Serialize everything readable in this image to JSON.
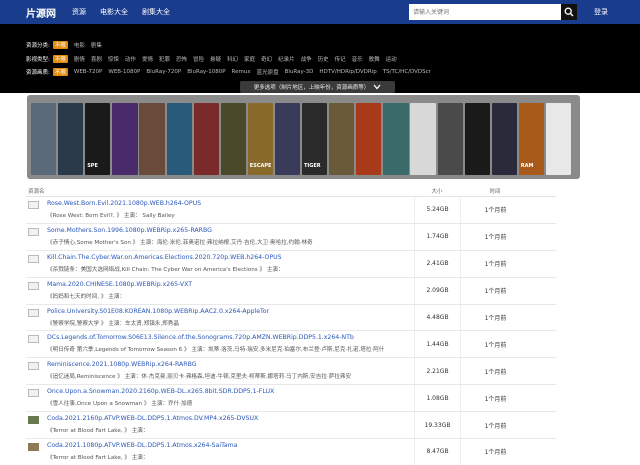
{
  "nav": {
    "logo": "片源网",
    "links": [
      "资源",
      "电影大全",
      "剧集大全"
    ],
    "search_placeholder": "请输入关键词",
    "login": "登录"
  },
  "filters": {
    "rows": [
      {
        "label": "资源分类:",
        "chips": [
          "不限",
          "电影",
          "剧集"
        ]
      },
      {
        "label": "影视类型:",
        "chips": [
          "不限",
          "剧情",
          "喜剧",
          "惊悚",
          "动作",
          "爱情",
          "犯罪",
          "恐怖",
          "冒险",
          "悬疑",
          "科幻",
          "家庭",
          "奇幻",
          "纪录片",
          "战争",
          "历史",
          "传记",
          "音乐",
          "歌舞",
          "运动"
        ]
      },
      {
        "label": "资源画质:",
        "chips": [
          "不限",
          "WEB-720P",
          "WEB-1080P",
          "BluRay-720P",
          "BluRay-1080P",
          "Remux",
          "蓝光原盘",
          "BluRay-3D",
          "HDTV/HDRip/DVDRip",
          "TS/TC/HC/DVDScr"
        ]
      }
    ],
    "more_options": "更多选项（制片地区，上映年份，资源画质等）"
  },
  "posters": [
    {
      "color": "#5a6a7a",
      "label": ""
    },
    {
      "color": "#2a3a4a",
      "label": ""
    },
    {
      "color": "#1a1a1a",
      "label": "SPE"
    },
    {
      "color": "#4a2a6a",
      "label": ""
    },
    {
      "color": "#6a4a3a",
      "label": ""
    },
    {
      "color": "#2a5a7a",
      "label": ""
    },
    {
      "color": "#7a2a2a",
      "label": ""
    },
    {
      "color": "#4a4a2a",
      "label": ""
    },
    {
      "color": "#8a6a2a",
      "label": "ESCAPE"
    },
    {
      "color": "#3a3a5a",
      "label": ""
    },
    {
      "color": "#2a2a2a",
      "label": "TIGER"
    },
    {
      "color": "#6a5a3a",
      "label": ""
    },
    {
      "color": "#a83a1a",
      "label": ""
    },
    {
      "color": "#3a6a6a",
      "label": ""
    },
    {
      "color": "#d8d8d8",
      "label": ""
    },
    {
      "color": "#4a4a4a",
      "label": ""
    },
    {
      "color": "#1a1a1a",
      "label": ""
    },
    {
      "color": "#2a2a3a",
      "label": ""
    },
    {
      "color": "#a85a1a",
      "label": "RAM"
    },
    {
      "color": "#e8e8e8",
      "label": ""
    }
  ],
  "table": {
    "headers": {
      "name": "资源名",
      "size": "大小",
      "time": "时间"
    },
    "rows": [
      {
        "title": "Rose.West.Born.Evil.2021.1080p.WEB.h264-OPUS",
        "sub": "《Rose West: Born Evil?, 》 主演： Sally Bailey",
        "size": "5.24GB",
        "time": "1个月前",
        "thumb": ""
      },
      {
        "title": "Some.Mothers.Son.1996.1080p.WEBRip.x265-RARBG",
        "sub": "《赤子情心,Some Mother's Son 》 主演：海伦·米伦,菲奥诺拉·弗拉纳根,艾丹·吉伦,大卫·奥哈拉,约翰·林奇",
        "size": "1.74GB",
        "time": "1个月前",
        "thumb": ""
      },
      {
        "title": "Kill.Chain.The.Cyber.War.on.Americas.Elections.2020.720p.WEB.h264-OPUS",
        "sub": "《杀戮链条：美国大选网络战,Kill Chain: The Cyber War on America's Elections 》 主演：",
        "size": "2.41GB",
        "time": "1个月前",
        "thumb": ""
      },
      {
        "title": "Mama.2020.CHINESE.1080p.WEBRip.x265-VXT",
        "sub": "《妈妈和七天的时间, 》 主演：",
        "size": "2.09GB",
        "time": "1个月前",
        "thumb": ""
      },
      {
        "title": "Police.University.S01E08.KOREAN.1080p.WEBRip.AAC2.0.x264-AppleTor",
        "sub": "《警察学院,警察大学 》 主演：车太贤,郑镇永,郑秀晶",
        "size": "4.48GB",
        "time": "1个月前",
        "thumb": ""
      },
      {
        "title": "DCs.Legends.of.Tomorrow.S06E13.Silence.of.the.Sonograms.720p.AMZN.WEBRip.DDP5.1.x264-NTb",
        "sub": "《明日传奇 第六季,Legends of Tomorrow Season 6 》 主演：凯蒂·洛茨,马特·瑞安,多米尼克·珀塞尔,布兰登·卢斯,尼克·扎诺,塔拉·阿什",
        "size": "1.44GB",
        "time": "1个月前",
        "thumb": ""
      },
      {
        "title": "Reminiscence.2021.1080p.WEBRip.x264-RARBG",
        "sub": "《追忆迷局,Reminiscence 》 主演：休·杰克曼,丽贝卡·弗格森,坦迪·牛顿,克里夫·柯蒂斯,娜塔莉·马丁内斯,安吉拉·萨拉弗安",
        "size": "2.21GB",
        "time": "1个月前",
        "thumb": ""
      },
      {
        "title": "Once.Upon.a.Snowman.2020.2160p.WEB-DL.x265.8bit.SDR.DDP5.1-FLUX",
        "sub": "《雪人往事,Once Upon a Snowman 》 主演：乔什·加德",
        "size": "1.08GB",
        "time": "1个月前",
        "thumb": ""
      },
      {
        "title": "Coda.2021.2160p.ATVP.WEB-DL.DDP5.1.Atmos.DV.MP4.x265-DVSUX",
        "sub": "《Terror at Blood Fart Lake, 》 主演：",
        "size": "19.33GB",
        "time": "1个月前",
        "thumb": "pic"
      },
      {
        "title": "Coda.2021.1080p.ATVP.WEB-DL.DDP5.1.Atmos.x264-SaiTama",
        "sub": "《Terror at Blood Fart Lake, 》 主演：",
        "size": "8.47GB",
        "time": "1个月前",
        "thumb": "pic2"
      }
    ]
  }
}
